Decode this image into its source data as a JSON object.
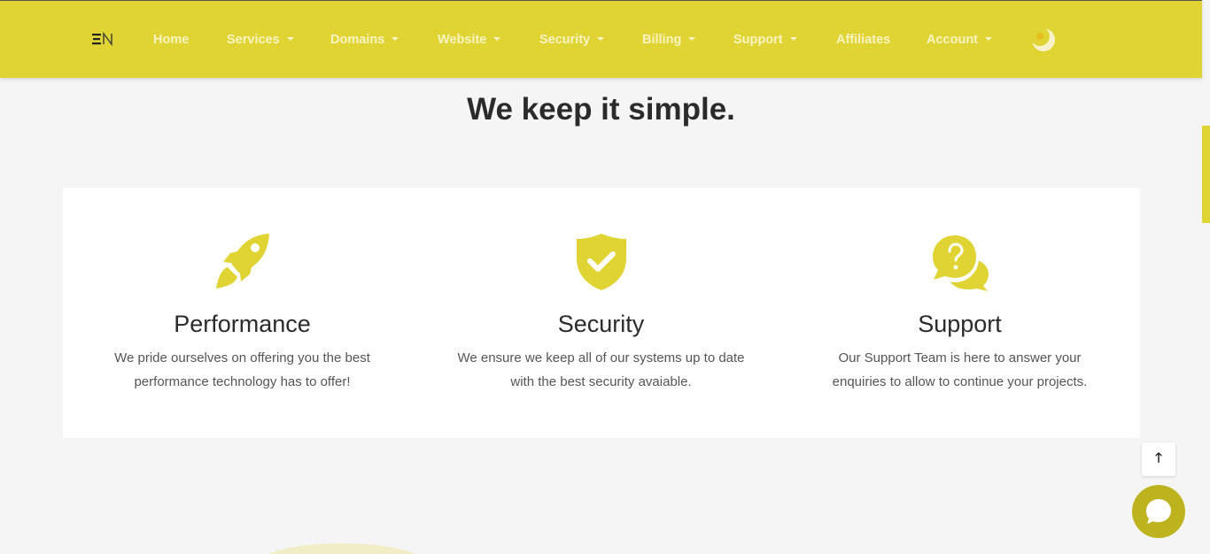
{
  "nav": {
    "logo_text": "EN",
    "items": [
      {
        "label": "Home",
        "dropdown": false
      },
      {
        "label": "Services",
        "dropdown": true
      },
      {
        "label": "Domains",
        "dropdown": true
      },
      {
        "label": "Website",
        "dropdown": true
      },
      {
        "label": "Security",
        "dropdown": true
      },
      {
        "label": "Billing",
        "dropdown": true
      },
      {
        "label": "Support",
        "dropdown": true
      },
      {
        "label": "Affiliates",
        "dropdown": false
      },
      {
        "label": "Account",
        "dropdown": true
      }
    ],
    "theme_toggle_icon": "moon-icon"
  },
  "main": {
    "heading": "We keep it simple.",
    "features": [
      {
        "icon": "rocket-icon",
        "title": "Performance",
        "line1": "We pride ourselves on offering you the best",
        "line2": "performance technology has to offer!"
      },
      {
        "icon": "shield-check-icon",
        "title": "Security",
        "line1": "We ensure we keep all of our systems up to date",
        "line2": "with the best security avaiable."
      },
      {
        "icon": "question-chat-icon",
        "title": "Support",
        "line1": "Our Support Team is here to answer your",
        "line2": "enquiries to allow to continue your projects."
      }
    ]
  },
  "widgets": {
    "scroll_top_icon": "arrow-up-icon",
    "scroll_top_glyph": "🡑",
    "chat_icon": "chat-bubble-icon"
  },
  "colors": {
    "accent": "#e0d435",
    "accent_dark": "#bdb31f",
    "nav_text": "#f8f3c2",
    "background": "#f5f5f5"
  }
}
